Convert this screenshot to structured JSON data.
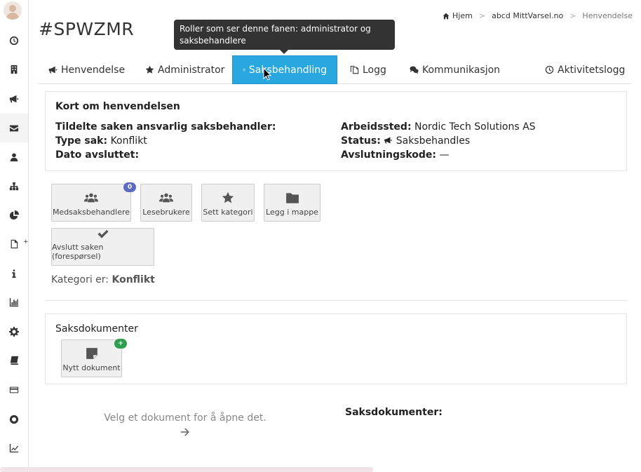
{
  "page": {
    "title": "#SPWZMR"
  },
  "breadcrumb": {
    "home": "Hjem",
    "org": "abcd MittVarsel.no",
    "current": "Henvendelse"
  },
  "tooltip": {
    "text": "Roller som ser denne fanen: administrator og saksbehandlere"
  },
  "sidebar": {
    "icons": [
      "dashboard-icon",
      "building-icon",
      "megaphone-icon",
      "envelope-icon",
      "user-icon",
      "sitemap-icon",
      "pie-chart-icon",
      "file-icon",
      "info-icon",
      "bar-chart-icon",
      "gear-icon",
      "book-icon",
      "credit-card-icon",
      "life-ring-icon",
      "line-chart-icon"
    ],
    "active": "envelope-icon"
  },
  "tabs": [
    {
      "label": "Henvendelse",
      "icon": "bullhorn-icon"
    },
    {
      "label": "Administrator",
      "icon": "star-icon"
    },
    {
      "label": "Saksbehandling",
      "icon": "document-icon",
      "active": true
    },
    {
      "label": "Logg",
      "icon": "copy-icon"
    },
    {
      "label": "Kommunikasjon",
      "icon": "chat-icon"
    },
    {
      "label": "Aktivitetslogg",
      "icon": "clock-icon"
    }
  ],
  "summary": {
    "heading": "Kort om henvendelsen",
    "assigned_label": "Tildelte saken ansvarlig saksbehandler:",
    "assigned_value": "",
    "type_label": "Type sak:",
    "type_value": "Konflikt",
    "closed_label": "Dato avsluttet:",
    "closed_value": "",
    "workplace_label": "Arbeidssted:",
    "workplace_value": "Nordic Tech Solutions AS",
    "status_label": "Status:",
    "status_value": "Saksbehandles",
    "closing_code_label": "Avslutningskode:",
    "closing_code_value": "—"
  },
  "actions": {
    "co_handlers": "Medsaksbehandlere",
    "co_handlers_count": "0",
    "readers": "Lesebrukere",
    "set_category": "Sett kategori",
    "add_to_folder": "Legg i mappe",
    "close_case": "Avslutt saken (forespørsel)"
  },
  "category": {
    "label": "Kategori er:",
    "value": "Konflikt"
  },
  "documents": {
    "heading": "Saksdokumenter",
    "new_document": "Nytt dokument",
    "new_badge": "+",
    "empty_hint": "Velg et dokument for å åpne det.",
    "list_label": "Saksdokumenter:"
  },
  "colors": {
    "active_tab": "#29a8e0",
    "badge": "#5c6bc0",
    "badge_green": "#2e9e4f",
    "tooltip_bg": "#333333"
  }
}
